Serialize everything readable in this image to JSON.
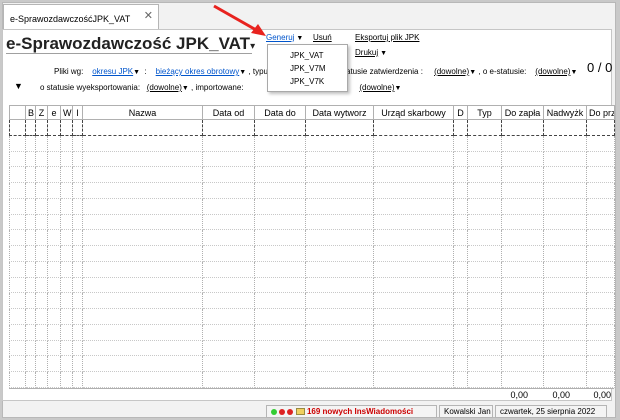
{
  "tab": {
    "label": "e-SprawozdawczośćJPK_VAT",
    "close": "✕"
  },
  "title": "e-Sprawozdawczość JPK_VAT",
  "toolbar": {
    "generuj": "Generuj",
    "usun": "Usuń",
    "eksportuj": "Eksportuj plik JPK",
    "drukuj": "Drukuj"
  },
  "generuj_menu": {
    "items": [
      "JPK_VAT",
      "JPK_V7M",
      "JPK_V7K"
    ]
  },
  "filters": {
    "row1_label": "Pliki wg:",
    "okres_value": "okresu JPK",
    "colon": ":",
    "period_value": "bieżący okres obrotowy",
    "typ_label": ", typu:",
    "zatw_label": "atusie zatwierdzenia :",
    "zatw_value": "(dowolne)",
    "estatus_label": ", o e-statusie:",
    "estatus_value": "(dowolne)",
    "row2_label": "o statusie wyeksportowania:",
    "wyeksport_value": "(dowolne)",
    "importowane_label": ", importowane:",
    "row2_colon": ":",
    "row2_value": "(dowolne)"
  },
  "counts": "0 / 0",
  "table": {
    "columns": [
      "B",
      "Z",
      "e",
      "W",
      "I",
      "Nazwa",
      "Data od",
      "Data do",
      "Data wytworz",
      "Urząd skarbowy",
      "D",
      "Typ",
      "Do zapła",
      "Nadwyżk",
      "Do prze"
    ],
    "empty_rows": 17
  },
  "totals": [
    "0,00",
    "0,00",
    "0,00"
  ],
  "statusbar": {
    "notifications": "169 nowych InsWiadomości",
    "user": "Kowalski Jan",
    "date": "czwartek, 25 sierpnia 2022"
  },
  "colors": {
    "link": "#0055cc",
    "annotation_arrow": "#e8231f",
    "notification": "#cc0000"
  }
}
